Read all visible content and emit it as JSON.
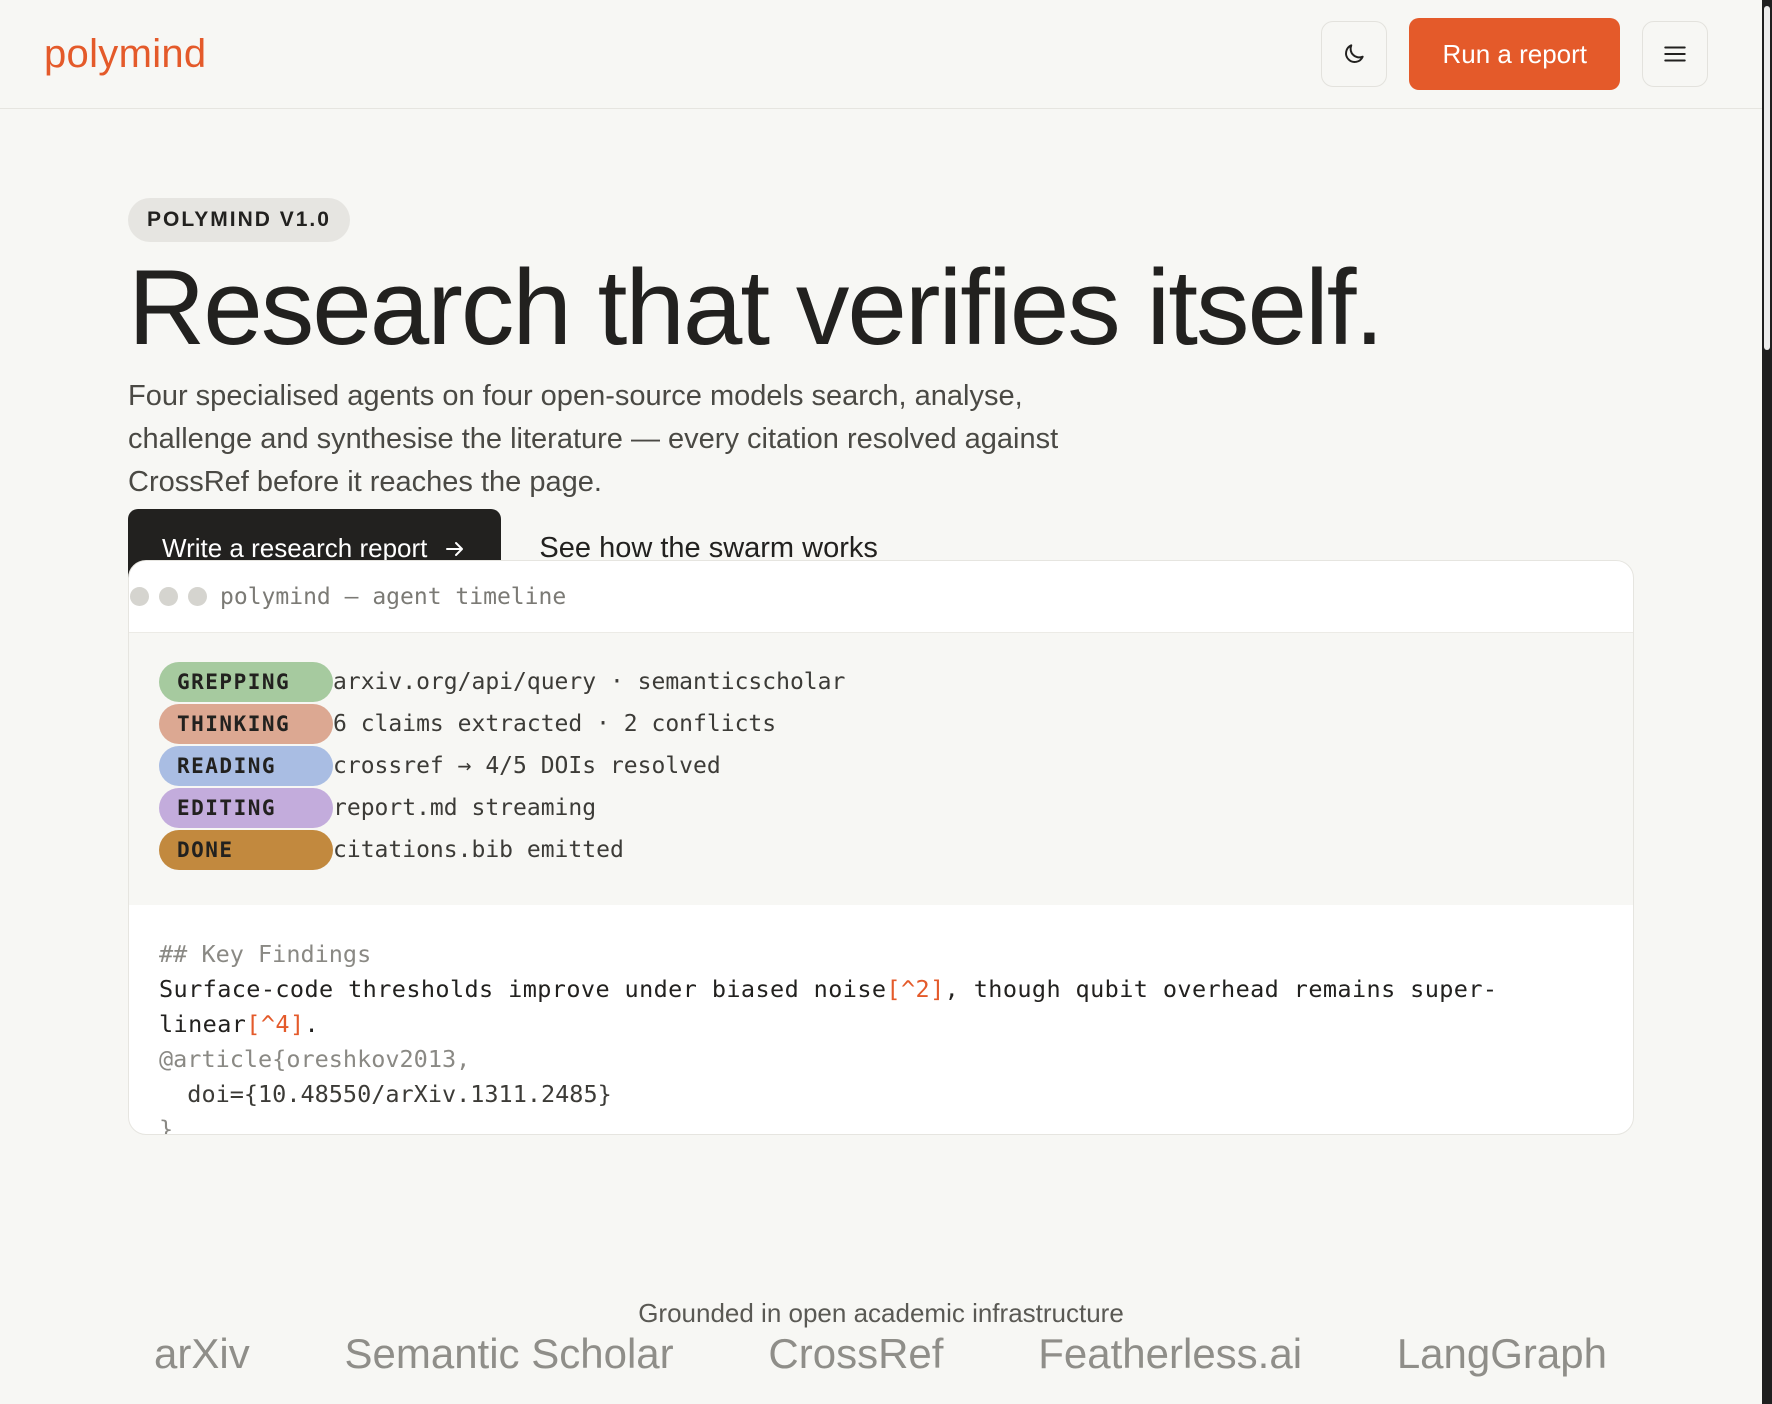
{
  "header": {
    "logo": "polymind",
    "run_label": "Run a report"
  },
  "hero": {
    "badge": "POLYMIND V1.0",
    "headline": "Research that verifies itself.",
    "lede": "Four specialised agents on four open-source models search, analyse, challenge and synthesise the literature — every citation resolved against CrossRef before it reaches the page.",
    "primary_cta": "Write a research report",
    "secondary_cta": "See how the swarm works"
  },
  "terminal": {
    "title": "polymind — agent timeline",
    "timeline": [
      {
        "status": "GREPPING",
        "text": "arxiv.org/api/query · semanticscholar",
        "color": "#a6ca9f"
      },
      {
        "status": "THINKING",
        "text": "6 claims extracted · 2 conflicts",
        "color": "#dca892"
      },
      {
        "status": "READING",
        "text": "crossref → 4/5 DOIs resolved",
        "color": "#a9bde3"
      },
      {
        "status": "EDITING",
        "text": "report.md streaming",
        "color": "#c3acdc"
      },
      {
        "status": "DONE",
        "text": "citations.bib emitted",
        "color": "#c2893e"
      }
    ],
    "code": {
      "heading": "## Key Findings",
      "line1_a": "Surface-code thresholds improve under biased noise",
      "line1_ref1": "[^2]",
      "line1_b": ", though qubit overhead remains super-linear",
      "line1_ref2": "[^4]",
      "line1_c": ".",
      "bib_open": "@article{oreshkov2013,",
      "bib_doi": "  doi={10.48550/arXiv.1311.2485}",
      "bib_close": "}"
    }
  },
  "footer": {
    "grounded": "Grounded in open academic infrastructure",
    "logos": [
      "arXiv",
      "Semantic Scholar",
      "CrossRef",
      "Featherless.ai",
      "LangGraph"
    ]
  },
  "colors": {
    "accent": "#e45a2a",
    "dark": "#22211f",
    "background": "#f7f7f4"
  }
}
